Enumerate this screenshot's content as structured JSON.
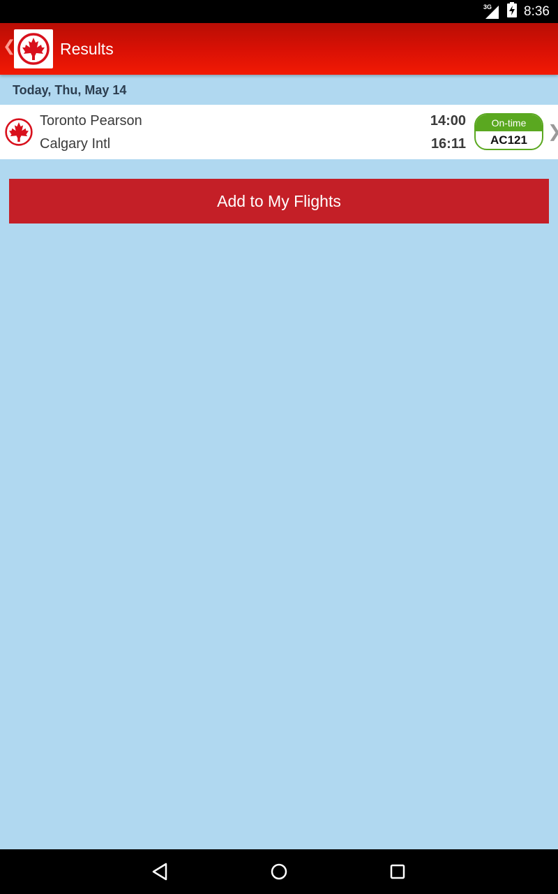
{
  "status_bar": {
    "network": "3G",
    "time": "8:36"
  },
  "app_bar": {
    "title": "Results",
    "logo_icon": "maple-leaf-icon"
  },
  "date_header": "Today, Thu, May 14",
  "flight": {
    "origin": "Toronto Pearson",
    "destination": "Calgary Intl",
    "departure_time": "14:00",
    "arrival_time": "16:11",
    "status": "On-time",
    "flight_number": "AC121",
    "status_color": "#5aa820"
  },
  "add_button_label": "Add to My Flights",
  "colors": {
    "brand_red": "#d81005",
    "button_red": "#c41f27",
    "background": "#b0d8f0"
  }
}
